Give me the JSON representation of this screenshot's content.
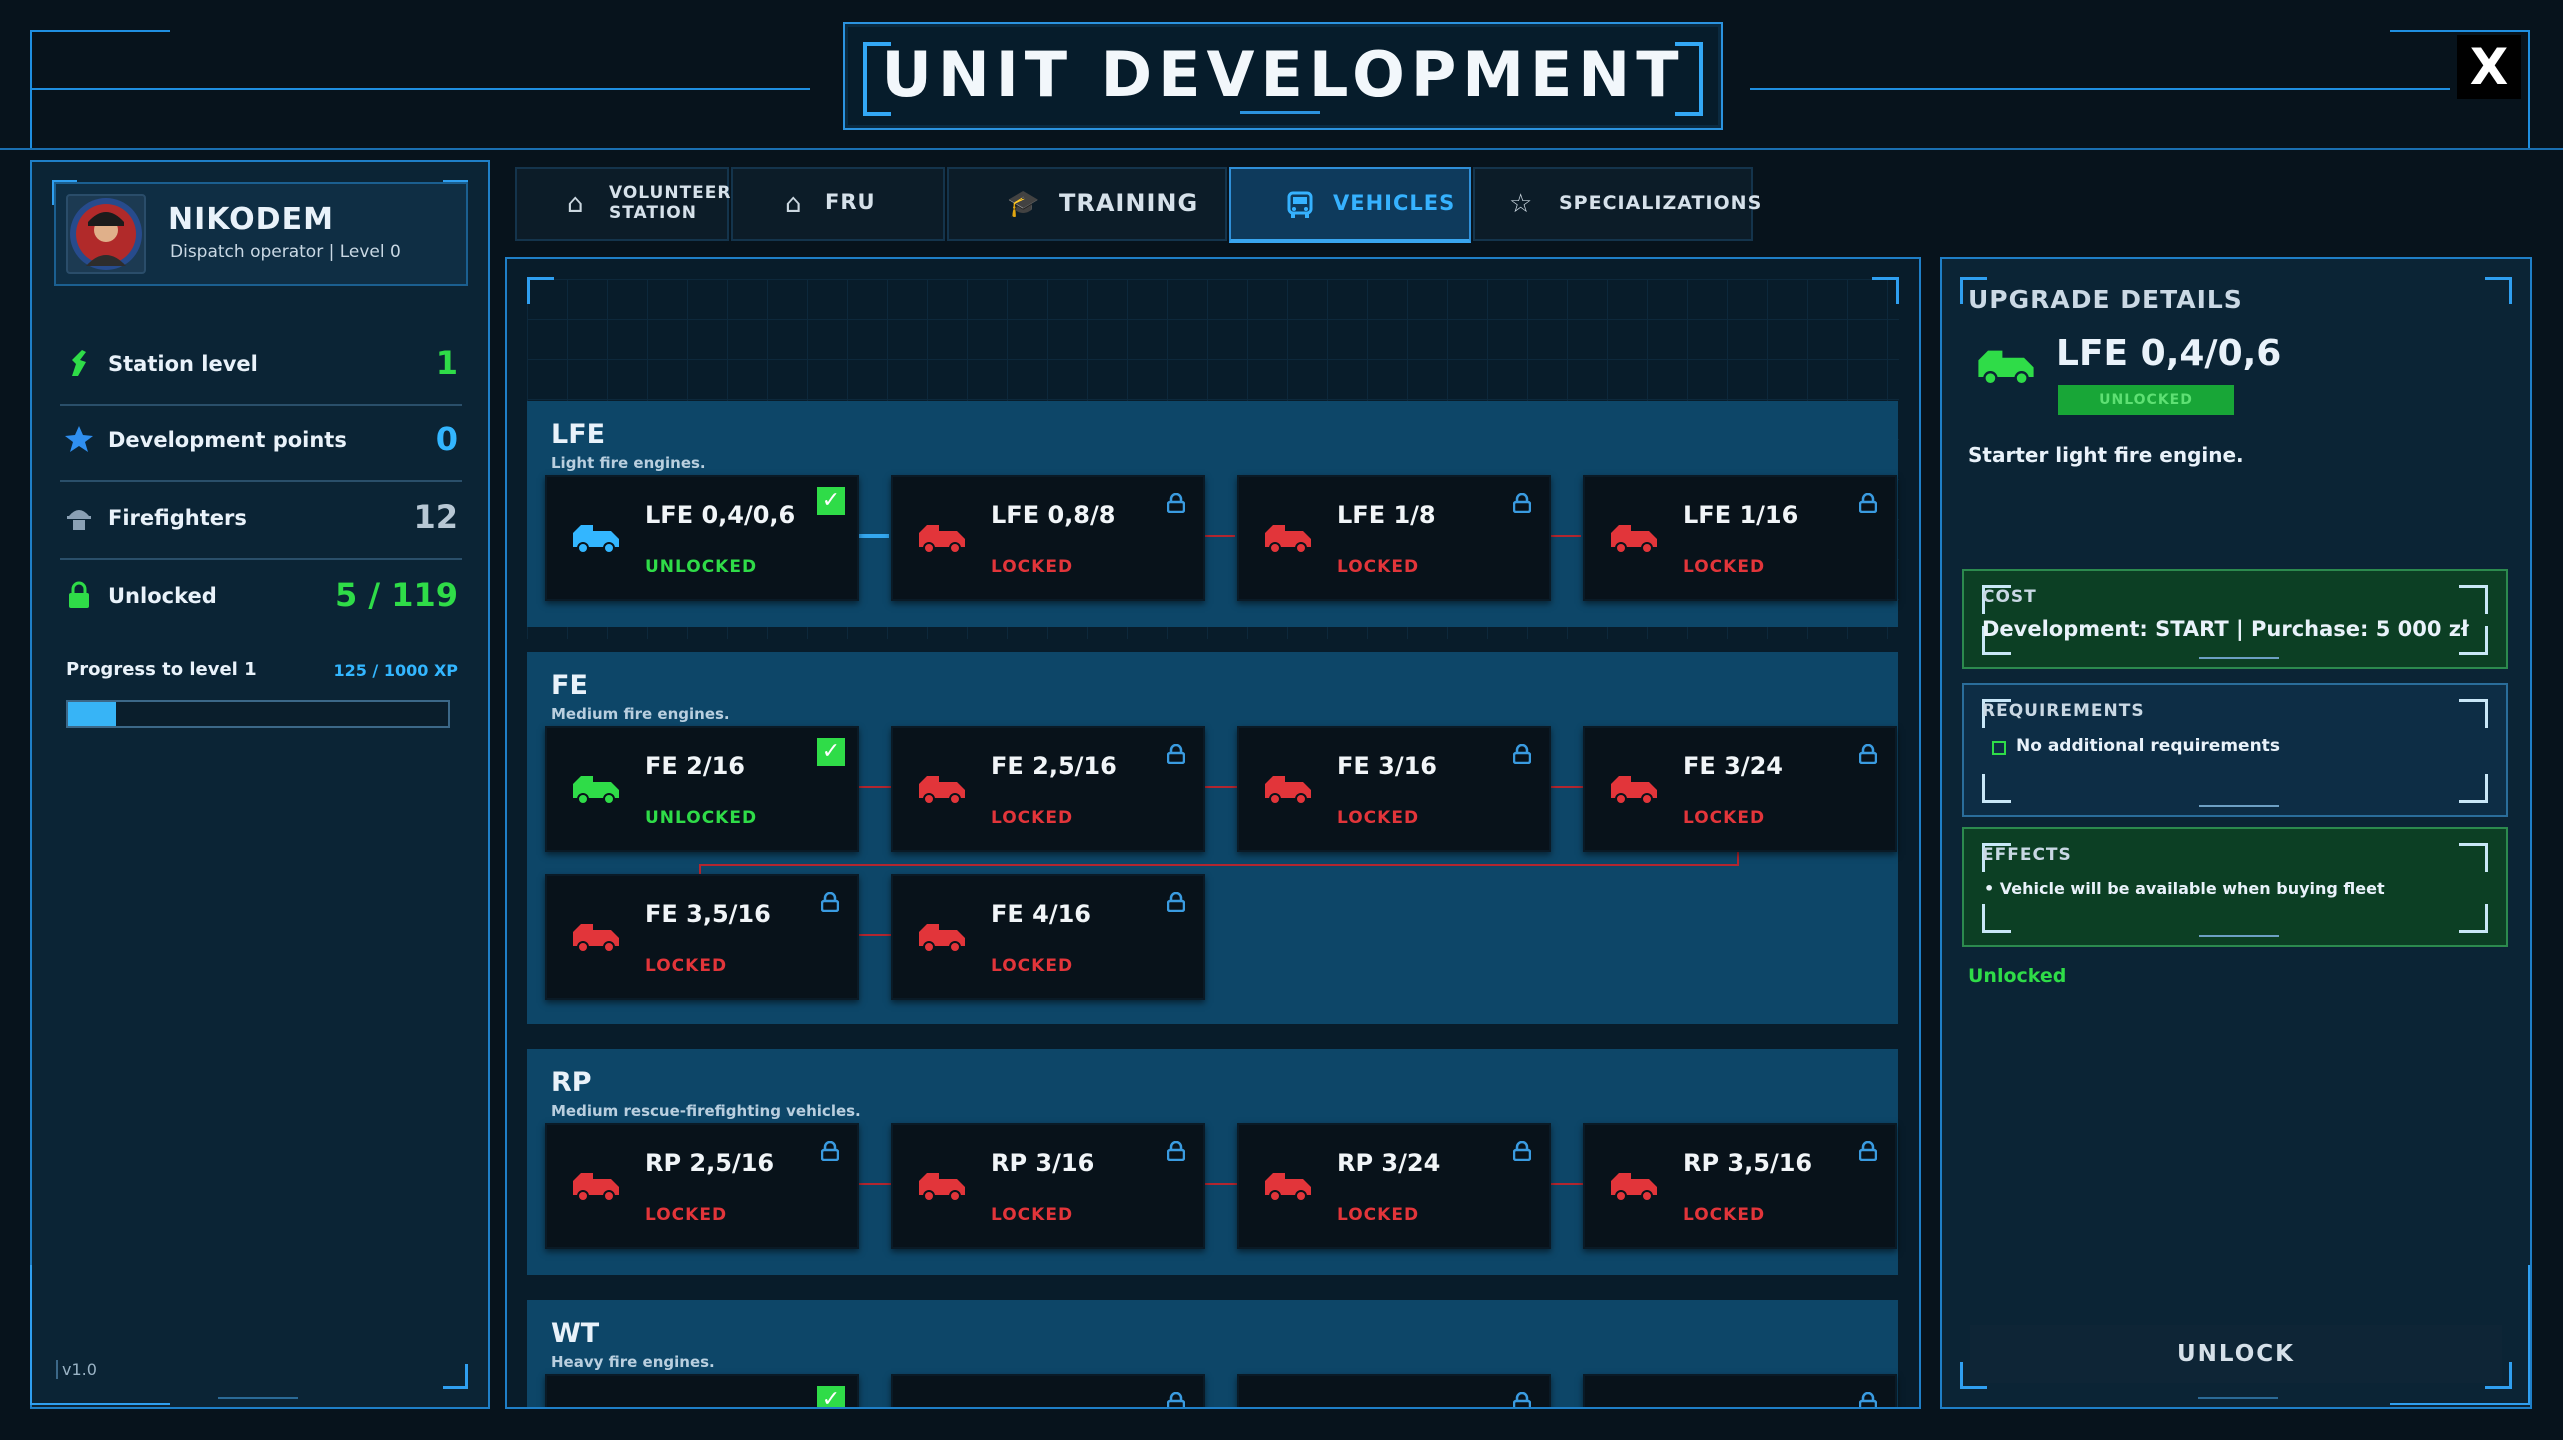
{
  "header": {
    "title": "UNIT DEVELOPMENT",
    "close_label": "X"
  },
  "profile": {
    "name": "NIKODEM",
    "subtitle": "Dispatch operator | Level 0"
  },
  "stats": [
    {
      "label": "Station level",
      "value": "1",
      "color": "#2fdc48",
      "icon": "rocket-icon"
    },
    {
      "label": "Development points",
      "value": "0",
      "color": "#33b6ff",
      "icon": "star-icon"
    },
    {
      "label": "Firefighters",
      "value": "12",
      "color": "#9fb6c7",
      "icon": "firefighter-icon"
    },
    {
      "label": "Unlocked",
      "value": "5 / 119",
      "color": "#2fdc48",
      "icon": "lock-icon"
    }
  ],
  "progress": {
    "label": "Progress to level 1",
    "xp_text": "125 / 1000 XP",
    "fraction": 0.125
  },
  "version": "v1.0",
  "tabs": [
    {
      "label": "VOLUNTEER STATION",
      "line1": "VOLUNTEER",
      "line2": "STATION",
      "icon": "station-icon",
      "active": false
    },
    {
      "label": "FRU",
      "icon": "building-icon",
      "active": false
    },
    {
      "label": "TRAINING",
      "icon": "graduation-cap-icon",
      "active": false
    },
    {
      "label": "VEHICLES",
      "icon": "bus-icon",
      "active": true
    },
    {
      "label": "SPECIALIZATIONS",
      "icon": "badge-star-icon",
      "active": false
    }
  ],
  "categories": [
    {
      "title": "LFE",
      "subtitle": "Light fire engines.",
      "vehicles": [
        {
          "name": "LFE 0,4/0,6",
          "status": "UNLOCKED",
          "unlocked": true,
          "selected": true
        },
        {
          "name": "LFE 0,8/8",
          "status": "LOCKED",
          "unlocked": false
        },
        {
          "name": "LFE 1/8",
          "status": "LOCKED",
          "unlocked": false
        },
        {
          "name": "LFE 1/16",
          "status": "LOCKED",
          "unlocked": false
        }
      ]
    },
    {
      "title": "FE",
      "subtitle": "Medium fire engines.",
      "vehicles": [
        {
          "name": "FE 2/16",
          "status": "UNLOCKED",
          "unlocked": true
        },
        {
          "name": "FE 2,5/16",
          "status": "LOCKED",
          "unlocked": false
        },
        {
          "name": "FE 3/16",
          "status": "LOCKED",
          "unlocked": false
        },
        {
          "name": "FE 3/24",
          "status": "LOCKED",
          "unlocked": false
        },
        {
          "name": "FE 3,5/16",
          "status": "LOCKED",
          "unlocked": false
        },
        {
          "name": "FE 4/16",
          "status": "LOCKED",
          "unlocked": false
        }
      ]
    },
    {
      "title": "RP",
      "subtitle": "Medium rescue-firefighting vehicles.",
      "vehicles": [
        {
          "name": "RP 2,5/16",
          "status": "LOCKED",
          "unlocked": false
        },
        {
          "name": "RP 3/16",
          "status": "LOCKED",
          "unlocked": false
        },
        {
          "name": "RP 3/24",
          "status": "LOCKED",
          "unlocked": false
        },
        {
          "name": "RP 3,5/16",
          "status": "LOCKED",
          "unlocked": false
        }
      ]
    },
    {
      "title": "WT",
      "subtitle": "Heavy fire engines."
    }
  ],
  "details": {
    "title": "UPGRADE DETAILS",
    "name": "LFE 0,4/0,6",
    "badge": "UNLOCKED",
    "description": "Starter light fire engine.",
    "cost_title": "COST",
    "cost_value": "Development: START | Purchase: 5 000 zł",
    "req_title": "REQUIREMENTS",
    "req_value": "No additional requirements",
    "effects_title": "EFFECTS",
    "effects_value": "• Vehicle will be available when buying fleet",
    "status": "Unlocked",
    "unlock_label": "UNLOCK"
  },
  "colors": {
    "accent": "#33b6ff",
    "unlocked": "#2fdc48",
    "locked": "#e2353a",
    "selected_truck": "#33b6ff"
  }
}
